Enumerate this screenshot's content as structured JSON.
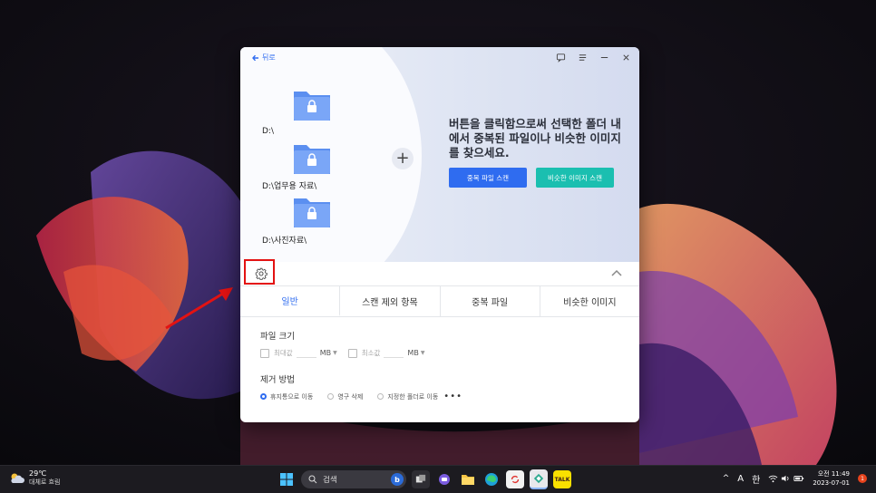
{
  "app": {
    "back_label": "뒤로",
    "folders": [
      {
        "path": "D:\\"
      },
      {
        "path": "D:\\업무용 자료\\"
      },
      {
        "path": "D:\\사진자료\\"
      }
    ],
    "hero_text": "버튼을 클릭함으로써 선택한 폴더 내에서 중복된 파일이나 비슷한 이미지를 찾으세요.",
    "scan_duplicate_label": "중복 파일 스캔",
    "scan_similar_label": "비슷한 이미지 스캔",
    "tabs": [
      "일반",
      "스캔 제외 항목",
      "중복 파일",
      "비슷한 이미지"
    ],
    "active_tab": "일반",
    "file_size": {
      "title": "파일 크기",
      "max_label": "최대값",
      "min_label": "최소값",
      "unit": "MB"
    },
    "removal": {
      "title": "제거 방법",
      "options": [
        "휴지통으로 이동",
        "영구 삭제",
        "지정한 폴더로 이동"
      ],
      "selected": "휴지통으로 이동",
      "more": "•••"
    },
    "colors": {
      "accent": "#2f6cf0",
      "secondary": "#1bbfb0",
      "highlight": "#e31212"
    }
  },
  "taskbar": {
    "weather_temp": "29℃",
    "weather_desc": "대체로 흐림",
    "search_placeholder": "검색",
    "tray_lang_a": "A",
    "tray_lang_han": "한",
    "clock_time": "오전 11:49",
    "clock_date": "2023-07-01",
    "notification_count": "1"
  }
}
